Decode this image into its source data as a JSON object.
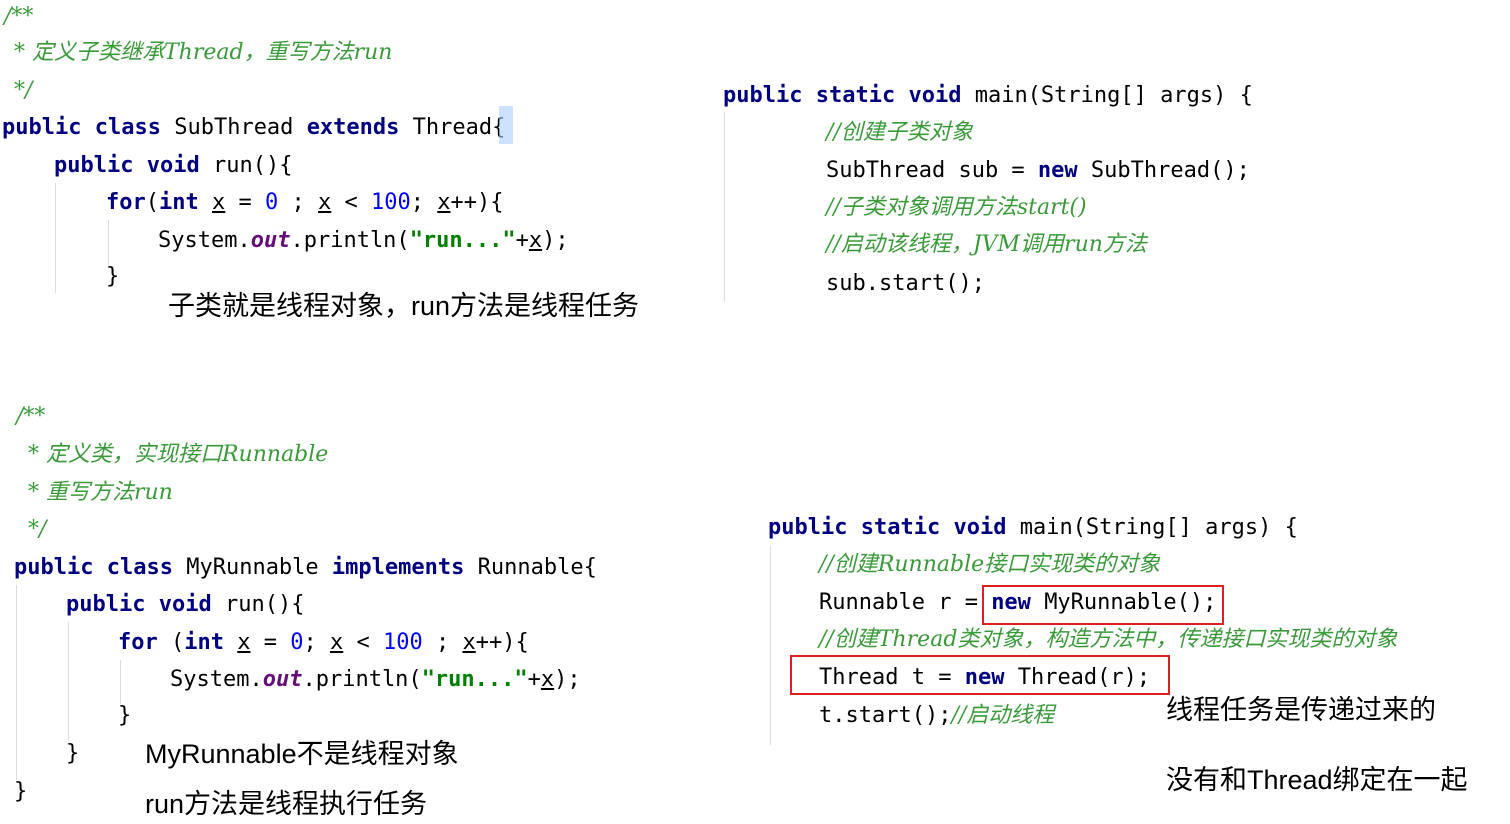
{
  "block1": {
    "doc": {
      "open": "/**",
      "line": "* 定义子类继承Thread，重写方法run",
      "close": "*/"
    },
    "class_decl": {
      "public": "public",
      "class": "class",
      "name": "SubThread",
      "extends": "extends",
      "parent": "Thread",
      "brace": "{"
    },
    "run_decl": {
      "public": "public",
      "void": "void",
      "name": "run(){"
    },
    "for_line": {
      "for": "for",
      "paren": "(",
      "int": "int",
      "x1": "x",
      "eq": " = ",
      "zero": "0",
      "sep1": " ; ",
      "x2": "x",
      "lt": " < ",
      "hundred": "100",
      "sep2": "; ",
      "x3": "x",
      "inc": "++){"
    },
    "print_line": {
      "system": "System.",
      "out": "out",
      "println": ".println(",
      "str": "\"run...\"",
      "plus": "+",
      "x": "x",
      "end": ");"
    },
    "close_brace": "}",
    "annotation": "子类就是线程对象，run方法是线程任务"
  },
  "main1": {
    "sig": {
      "public": "public",
      "static": "static",
      "void": "void",
      "rest": "main(String[] args) {"
    },
    "comment1": "//创建子类对象",
    "decl": {
      "type": "SubThread sub = ",
      "new": "new",
      "ctor": "SubThread();"
    },
    "comment2": "//子类对象调用方法start()",
    "comment3": "//启动该线程，JVM调用run方法",
    "start": "sub.start();"
  },
  "block2": {
    "doc": {
      "open": "/**",
      "line1": "* 定义类，实现接口Runnable",
      "line2": "* 重写方法run",
      "close": "*/"
    },
    "class_decl": {
      "public": "public",
      "class": "class",
      "name": "MyRunnable",
      "implements": "implements",
      "iface": "Runnable{"
    },
    "run_decl": {
      "public": "public",
      "void": "void",
      "name": "run(){"
    },
    "for_line": {
      "for": "for",
      "paren": " (",
      "int": "int",
      "x1": "x",
      "eq": " = ",
      "zero": "0",
      "sep1": "; ",
      "x2": "x",
      "lt": " < ",
      "hundred": "100",
      "sep2": " ; ",
      "x3": "x",
      "inc": "++){"
    },
    "print_line": {
      "system": "System.",
      "out": "out",
      "println": ".println(",
      "str": "\"run...\"",
      "plus": "+",
      "x": "x",
      "end": ");"
    },
    "close_inner": "}",
    "close_method": "}",
    "close_class": "}",
    "annotation1": "MyRunnable不是线程对象",
    "annotation2": "run方法是线程执行任务"
  },
  "main2": {
    "sig": {
      "public": "public",
      "static": "static",
      "void": "void",
      "rest": "main(String[] args) {"
    },
    "comment1": "//创建Runnable接口实现类的对象",
    "decl1": {
      "type": "Runnable r = ",
      "new": "new",
      "ctor": "MyRunnable();"
    },
    "comment2": "//创建Thread类对象，构造方法中，传递接口实现类的对象",
    "decl2": {
      "type": "Thread t = ",
      "new": "new",
      "ctor": "Thread(r);"
    },
    "start_code": "t.start();",
    "start_comment": "//启动线程",
    "annotation1": "线程任务是传递过来的",
    "annotation2": "没有和Thread绑定在一起"
  },
  "colors": {
    "keyword": "#000080",
    "comment": "#3a9a3a",
    "number": "#0000ff",
    "string": "#008000",
    "field": "#660e7a",
    "highlight_box": "#e02020"
  }
}
